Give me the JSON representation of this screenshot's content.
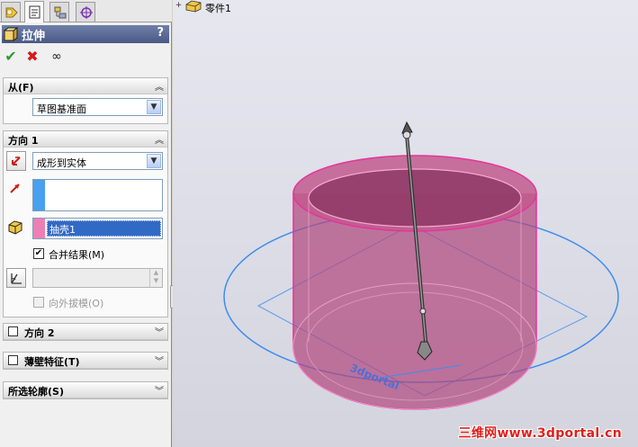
{
  "tabs": [
    {
      "icon": "feature-manager-icon"
    },
    {
      "icon": "property-manager-icon"
    },
    {
      "icon": "configuration-manager-icon"
    },
    {
      "icon": "dimxpert-icon"
    }
  ],
  "title": {
    "label": "拉伸",
    "help": "?"
  },
  "actions": {
    "ok_icon": "✔",
    "cancel_icon": "✖",
    "preview_icon": "∞"
  },
  "from_section": {
    "label": "从(F)",
    "start_condition": "草图基准面"
  },
  "direction1": {
    "label": "方向 1",
    "end_condition": "成形到实体",
    "selected_body": "抽壳1",
    "merge_result": {
      "label": "合并结果(M)",
      "checked": true
    },
    "draft_outward": {
      "label": "向外拔模(O)",
      "checked": false
    }
  },
  "direction2": {
    "label": "方向 2"
  },
  "thin_feature": {
    "label": "薄壁特征(T)"
  },
  "selected_contours": {
    "label": "所选轮廓(S)"
  },
  "tree": {
    "part_name": "零件1"
  },
  "watermark": "三维网www.3dportal.cn",
  "model_text": "3dportal",
  "colors": {
    "accent_pink": "#c0407a",
    "accent_blue": "#3e8cf0",
    "selection_blue": "#316ac5"
  }
}
